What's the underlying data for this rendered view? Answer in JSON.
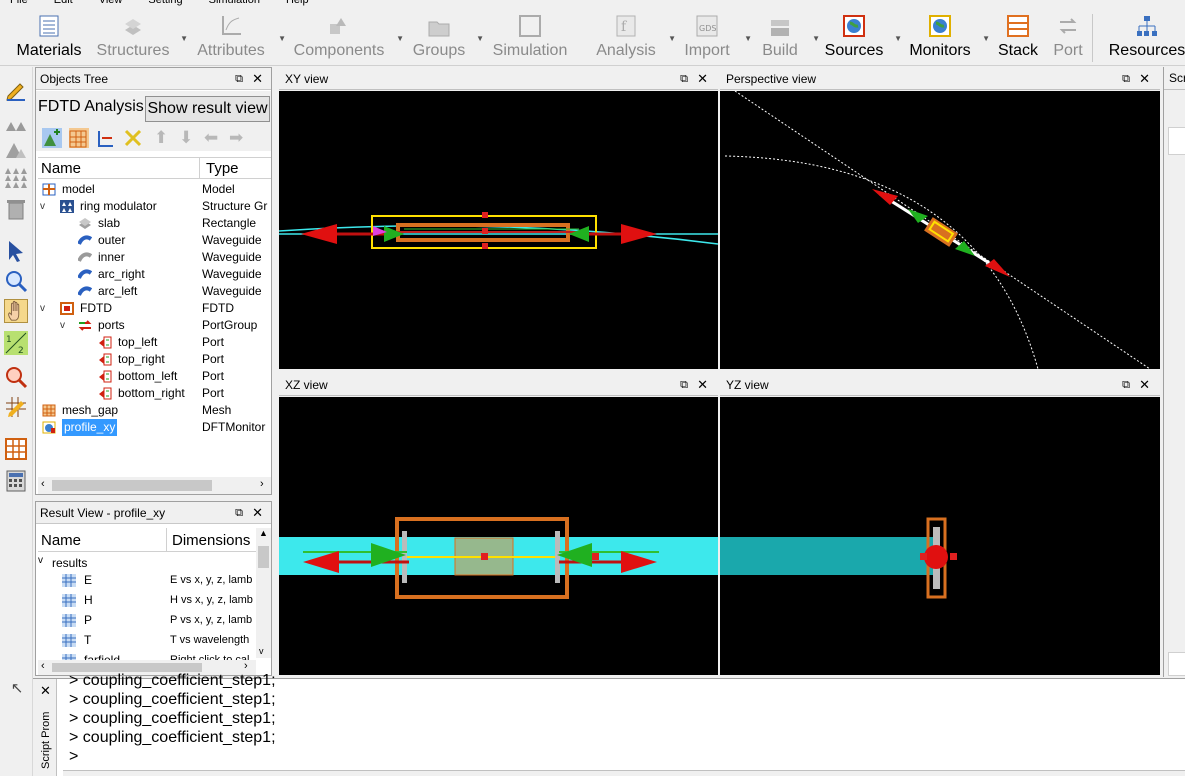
{
  "menu": [
    "File",
    "Edit",
    "View",
    "Setting",
    "Simulation",
    "Help"
  ],
  "toolbar": [
    {
      "label": "Materials",
      "enabled": true,
      "icon": "materials-icon",
      "dropdown": false
    },
    {
      "label": "Structures",
      "enabled": false,
      "icon": "structures-icon",
      "dropdown": true
    },
    {
      "label": "Attributes",
      "enabled": false,
      "icon": "attributes-icon",
      "dropdown": true
    },
    {
      "label": "Components",
      "enabled": false,
      "icon": "components-icon",
      "dropdown": true
    },
    {
      "label": "Groups",
      "enabled": false,
      "icon": "groups-icon",
      "dropdown": true
    },
    {
      "label": "Simulation",
      "enabled": false,
      "icon": "simulation-icon",
      "dropdown": false
    },
    {
      "label": "Analysis",
      "enabled": false,
      "icon": "analysis-icon",
      "dropdown": true
    },
    {
      "label": "Import",
      "enabled": false,
      "icon": "gds-import-icon",
      "dropdown": true
    },
    {
      "label": "Build",
      "enabled": false,
      "icon": "build-icon",
      "dropdown": true
    },
    {
      "label": "Sources",
      "enabled": true,
      "icon": "sources-icon",
      "dropdown": true
    },
    {
      "label": "Monitors",
      "enabled": true,
      "icon": "monitors-icon",
      "dropdown": true
    },
    {
      "label": "Stack",
      "enabled": true,
      "icon": "stack-icon",
      "dropdown": false
    },
    {
      "label": "Port",
      "enabled": false,
      "icon": "port-icon",
      "dropdown": false
    },
    {
      "label": "Resources",
      "enabled": true,
      "icon": "resources-icon",
      "dropdown": false
    }
  ],
  "objects_tree": {
    "title": "Objects Tree",
    "mode_label": "FDTD Analysis",
    "show_result_button": "Show result view",
    "col_name": "Name",
    "col_type": "Type",
    "rows": [
      {
        "name": "model",
        "type": "Model",
        "level": 0,
        "expander": "",
        "icon": "model-icon"
      },
      {
        "name": "ring modulator",
        "type": "Structure Gr",
        "level": 0,
        "expander": "v",
        "icon": "structure-group-icon"
      },
      {
        "name": "slab",
        "type": "Rectangle",
        "level": 1,
        "expander": "",
        "icon": "rectangle-icon"
      },
      {
        "name": "outer",
        "type": "Waveguide",
        "level": 1,
        "expander": "",
        "icon": "waveguide-icon"
      },
      {
        "name": "inner",
        "type": "Waveguide",
        "level": 1,
        "expander": "",
        "icon": "waveguide-gray-icon"
      },
      {
        "name": "arc_right",
        "type": "Waveguide",
        "level": 1,
        "expander": "",
        "icon": "waveguide-icon"
      },
      {
        "name": "arc_left",
        "type": "Waveguide",
        "level": 1,
        "expander": "",
        "icon": "waveguide-icon"
      },
      {
        "name": "FDTD",
        "type": "FDTD",
        "level": 0,
        "expander": "v",
        "icon": "fdtd-icon"
      },
      {
        "name": "ports",
        "type": "PortGroup",
        "level": 1,
        "expander": "v",
        "icon": "port-group-icon"
      },
      {
        "name": "top_left",
        "type": "Port",
        "level": 2,
        "expander": "",
        "icon": "port-icon"
      },
      {
        "name": "top_right",
        "type": "Port",
        "level": 2,
        "expander": "",
        "icon": "port-icon"
      },
      {
        "name": "bottom_left",
        "type": "Port",
        "level": 2,
        "expander": "",
        "icon": "port-icon"
      },
      {
        "name": "bottom_right",
        "type": "Port",
        "level": 2,
        "expander": "",
        "icon": "port-icon"
      },
      {
        "name": "mesh_gap",
        "type": "Mesh",
        "level": 0,
        "expander": "",
        "icon": "mesh-icon"
      },
      {
        "name": "profile_xy",
        "type": "DFTMonitor",
        "level": 0,
        "expander": "",
        "icon": "dft-monitor-icon",
        "selected": true
      }
    ]
  },
  "result_view": {
    "title": "Result View - profile_xy",
    "col_name": "Name",
    "col_dims": "Dimensions",
    "group": "results",
    "rows": [
      {
        "name": "E",
        "dims": "E vs x, y, z, lamb"
      },
      {
        "name": "H",
        "dims": "H vs x, y, z, lamb"
      },
      {
        "name": "P",
        "dims": "P vs x, y, z, lamb"
      },
      {
        "name": "T",
        "dims": "T vs wavelength"
      },
      {
        "name": "farfield",
        "dims": "Right click to cal"
      }
    ]
  },
  "views": {
    "xy": "XY view",
    "perspective": "Perspective view",
    "xz": "XZ view",
    "yz": "YZ view",
    "script": "Scr"
  },
  "console": {
    "tab_label": "Script Prompt",
    "lines": [
      "> coupling_coefficient_step1;",
      "> coupling_coefficient_step1;",
      "> coupling_coefficient_step1;",
      "> coupling_coefficient_step1;",
      ">"
    ]
  },
  "colors": {
    "waveguide": "#3de8ec",
    "slab": "#d87020",
    "monitor": "#ffe000",
    "source_red": "#e01010",
    "source_green": "#20c020"
  }
}
